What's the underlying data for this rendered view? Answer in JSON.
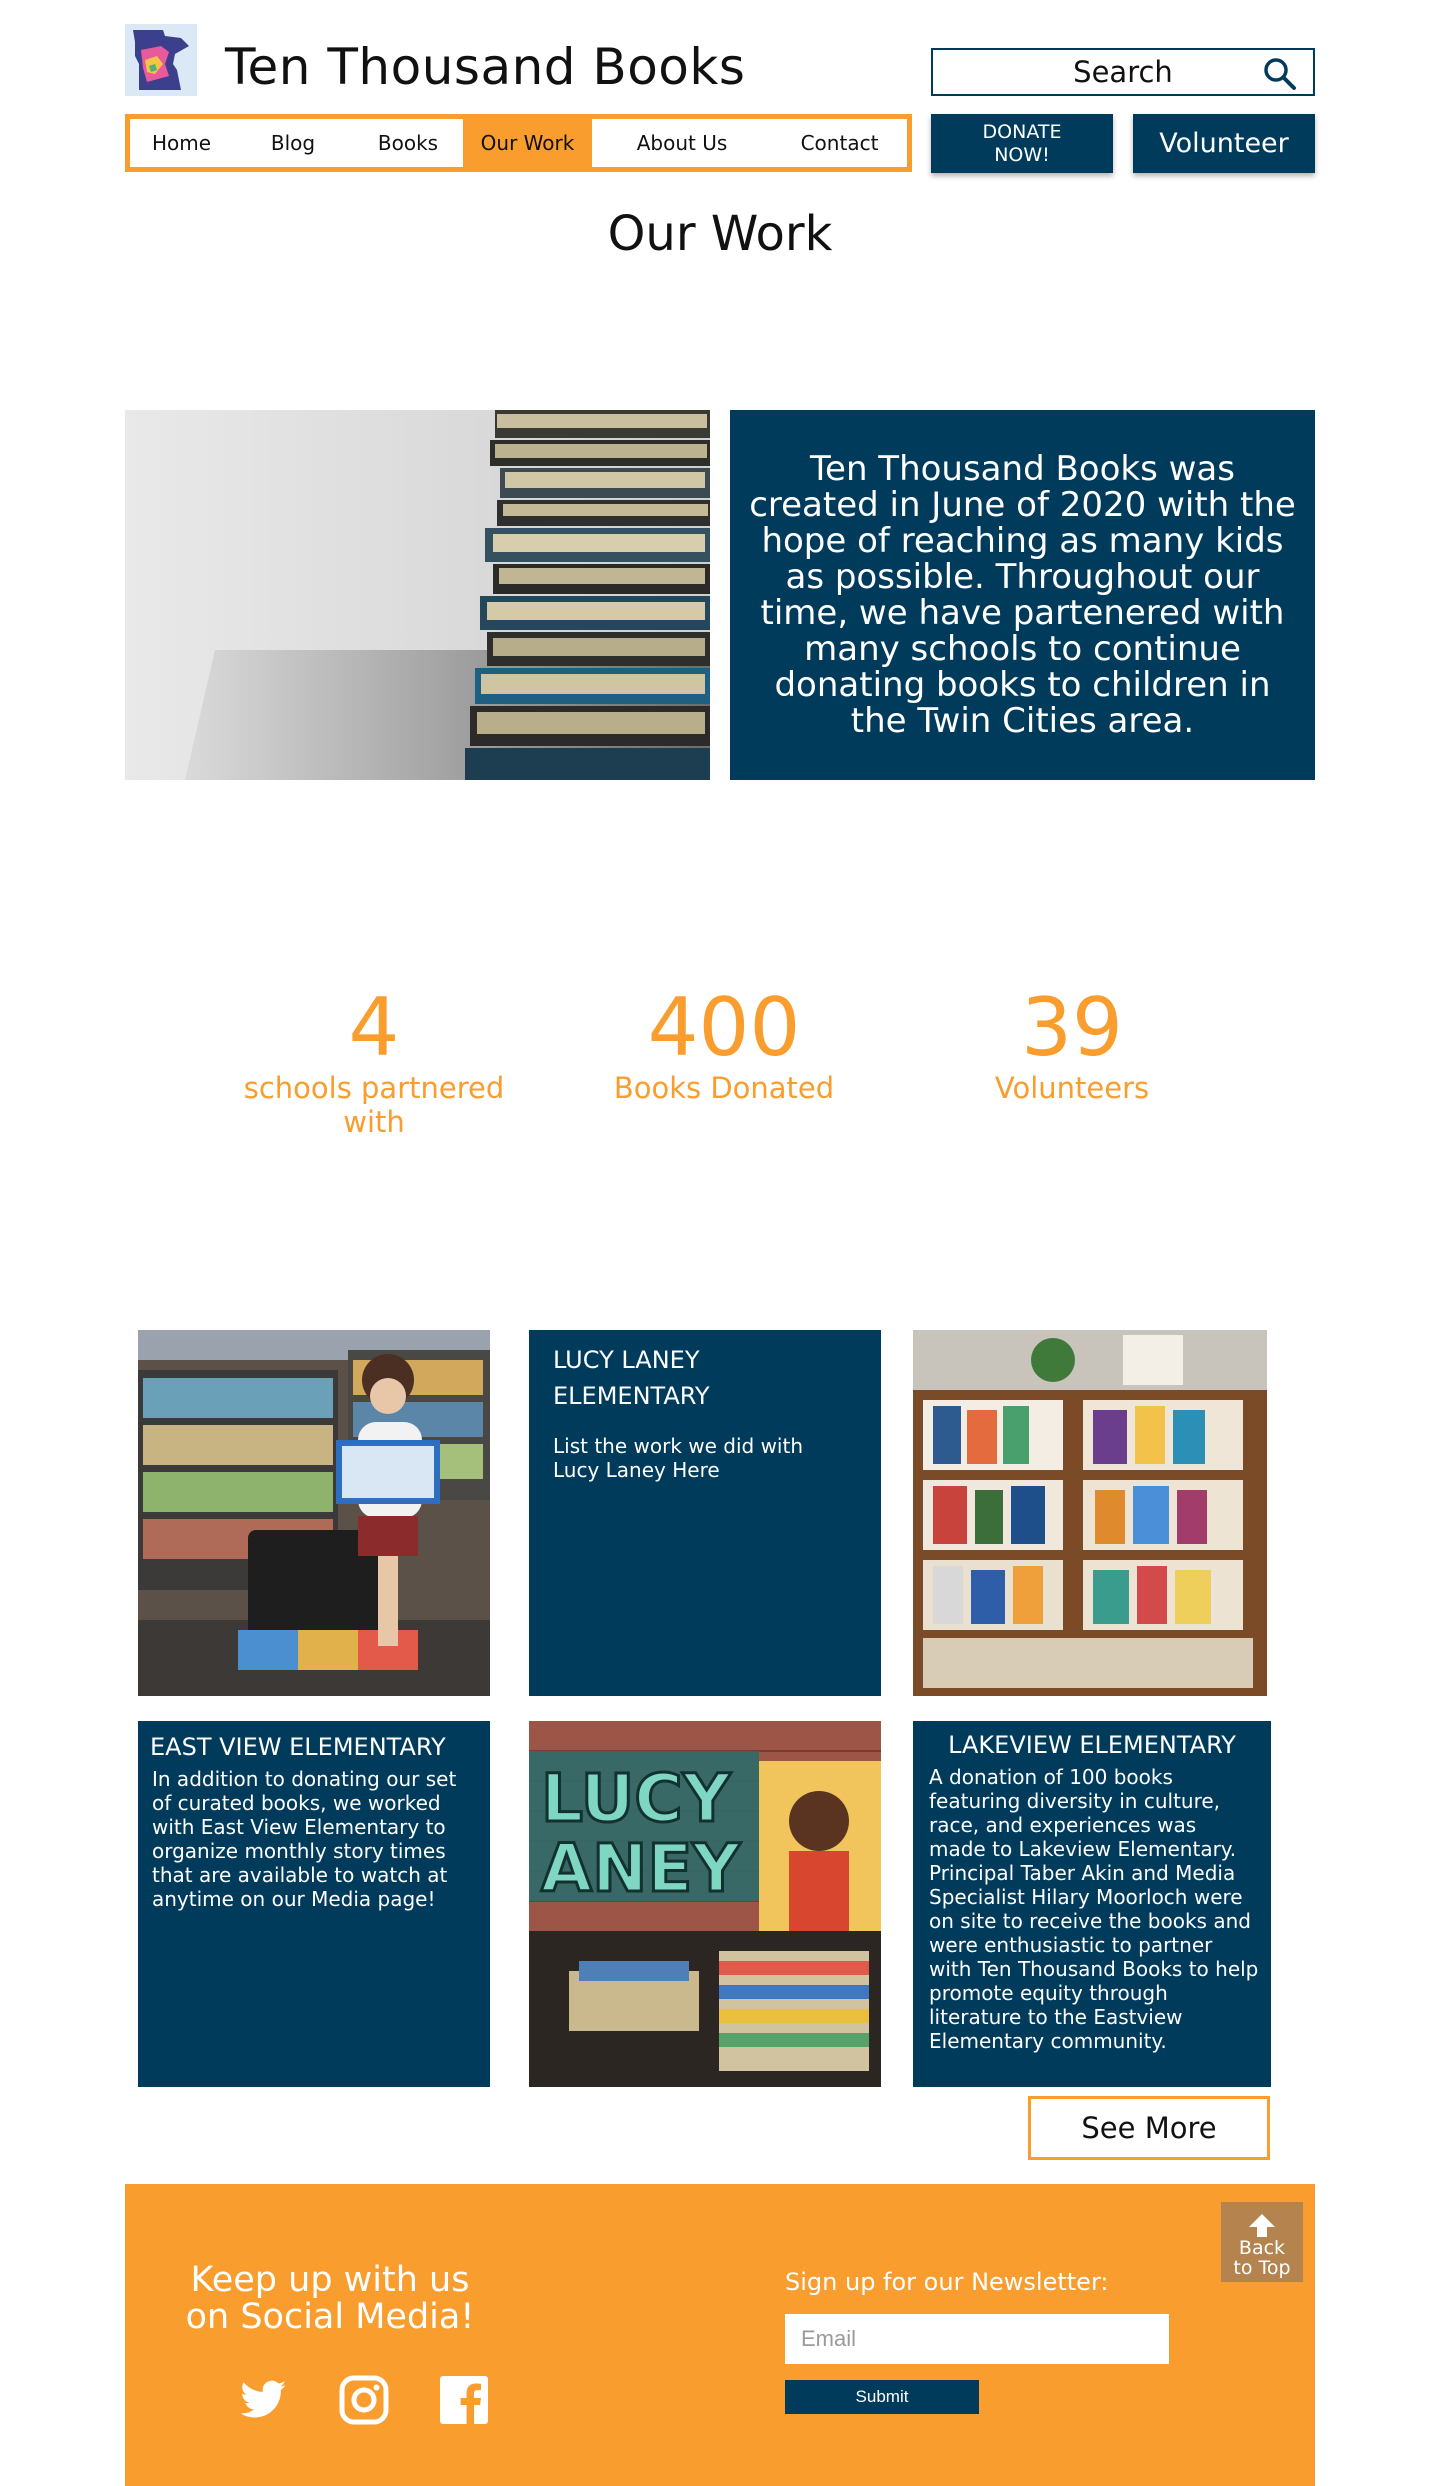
{
  "header": {
    "site_title": "Ten Thousand Books",
    "search_label": "Search",
    "donate_label": "DONATE NOW!",
    "volunteer_label": "Volunteer"
  },
  "nav": {
    "items": [
      {
        "label": "Home",
        "active": false
      },
      {
        "label": "Blog",
        "active": false
      },
      {
        "label": "Books",
        "active": false
      },
      {
        "label": "Our Work",
        "active": true
      },
      {
        "label": "About Us",
        "active": false
      },
      {
        "label": "Contact",
        "active": false
      }
    ]
  },
  "page": {
    "title": "Our Work",
    "intro": "Ten Thousand Books was created in June of 2020 with the hope of reaching as many kids as possible. Throughout our time, we have partenered with many schools to continue donating books to children in the Twin Cities area."
  },
  "stats": [
    {
      "value": "4",
      "label": "schools partnered with"
    },
    {
      "value": "400",
      "label": "Books Donated"
    },
    {
      "value": "39",
      "label": "Volunteers"
    }
  ],
  "cards": {
    "lucy_laney": {
      "title": "LUCY LANEY ELEMENTARY",
      "body": "List the work we did with Lucy Laney Here"
    },
    "east_view": {
      "title": "EAST VIEW ELEMENTARY",
      "body": "In addition to donating our set of curated books, we worked with East View Elementary to organize monthly story times that are available to watch at anytime on our Media page!"
    },
    "lakeview": {
      "title": "LAKEVIEW ELEMENTARY",
      "body": "A donation of 100 books featuring diversity in culture, race, and experiences was made to Lakeview Elementary. Principal Taber Akin and Media Specialist Hilary Moorloch were on site to receive the books and were enthusiastic to partner with Ten Thousand Books to help promote equity through literature to the Eastview Elementary community."
    },
    "see_more_label": "See More"
  },
  "footer": {
    "social_heading": "Keep up with us on Social Media!",
    "social_icons": [
      "twitter-icon",
      "instagram-icon",
      "facebook-icon"
    ],
    "newsletter_label": "Sign up for our Newsletter:",
    "email_placeholder": "Email",
    "submit_label": "Submit",
    "back_to_top": "Back to Top"
  },
  "colors": {
    "navy": "#003b5c",
    "orange": "#f99d2e",
    "back_to_top": "#b5834e"
  }
}
